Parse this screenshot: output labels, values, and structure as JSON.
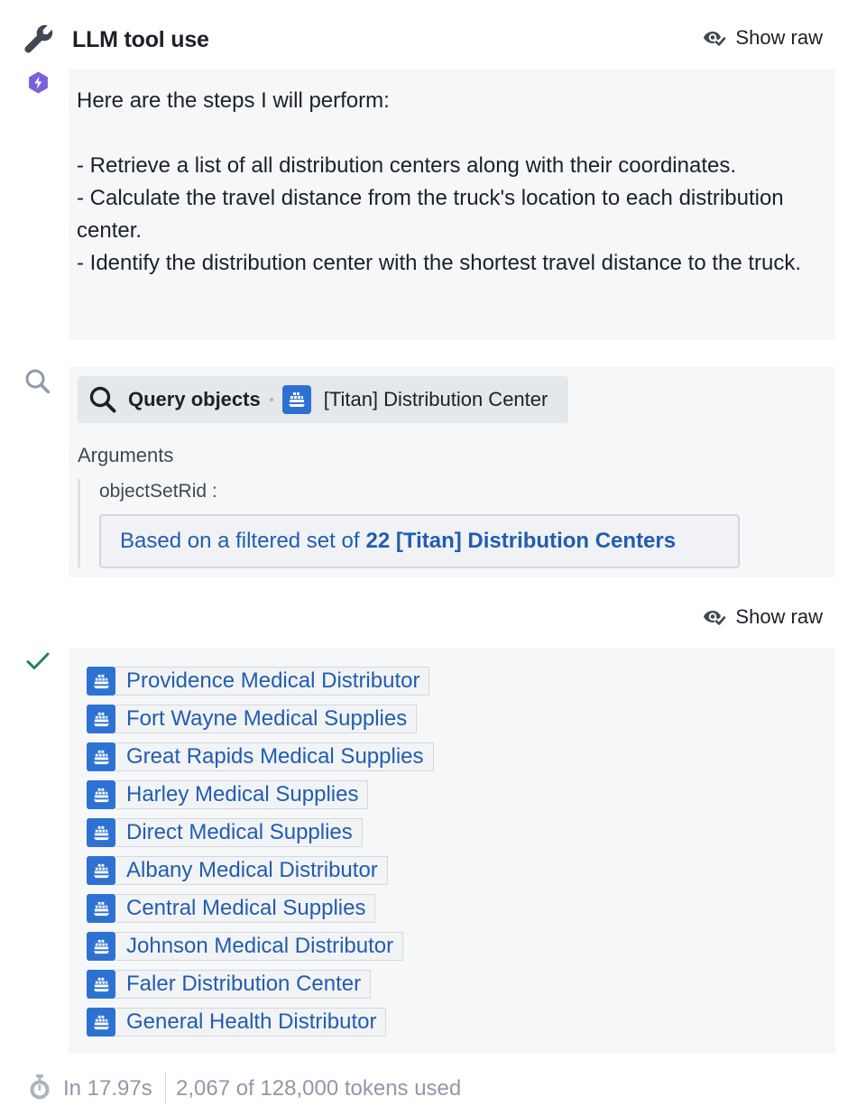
{
  "header": {
    "title": "LLM tool use",
    "show_raw_label": "Show raw"
  },
  "thought": {
    "text": "Here are the steps I will perform:\n\n- Retrieve a list of all distribution centers along with their coordinates.\n- Calculate the travel distance from the truck's location to each distribution center.\n- Identify the distribution center with the shortest travel distance to the truck."
  },
  "tool_call": {
    "tool_name": "Query objects",
    "object_type": "[Titan] Distribution Center",
    "arguments_label": "Arguments",
    "argument_key": "objectSetRid :",
    "argument_prefix": "Based on a filtered set of",
    "argument_link": "22 [Titan] Distribution Centers"
  },
  "result": {
    "show_raw_label": "Show raw",
    "items": [
      "Providence Medical Distributor",
      "Fort Wayne Medical Supplies",
      "Great Rapids Medical Supplies",
      "Harley Medical Supplies",
      "Direct Medical Supplies",
      "Albany Medical Distributor",
      "Central Medical Supplies",
      "Johnson Medical Distributor",
      "Faler Distribution Center",
      "General Health Distributor"
    ]
  },
  "footer": {
    "time": "In 17.97s",
    "tokens": "2,067 of 128,000 tokens used"
  },
  "icons": {
    "header": "wrench-icon",
    "thought": "aip-logo-icon",
    "tool": "search-icon",
    "object": "cube-icon",
    "result": "checkmark-icon",
    "footer": "stopwatch-icon",
    "show_raw": "eye-check-icon"
  },
  "colors": {
    "link": "#215db0",
    "object_icon_bg": "#2d72d2",
    "aip_purple": "#7961db",
    "success": "#238551",
    "panel_bg": "#f6f7f9"
  }
}
